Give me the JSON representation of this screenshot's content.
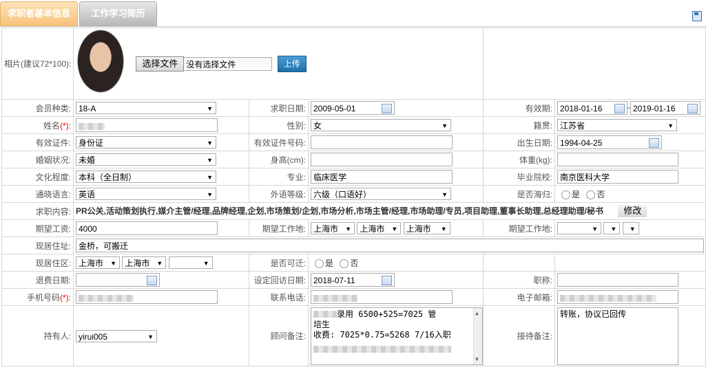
{
  "tabs": {
    "active": "求职者基本信息",
    "inactive": "工作学习简历"
  },
  "photo": {
    "label": "相片(建议72*100):",
    "choose_file": "选择文件",
    "no_file": "没有选择文件",
    "upload": "上传"
  },
  "row1": {
    "member_type_label": "会员种类:",
    "member_type": "18-A",
    "apply_date_label": "求职日期:",
    "apply_date": "2009-05-01",
    "valid_label": "有效期:",
    "valid_from": "2018-01-16",
    "valid_sep": "-",
    "valid_to": "2019-01-16"
  },
  "row2": {
    "name_label": "姓名",
    "req": "(*)",
    "gender_label": "性别:",
    "gender": "女",
    "native_label": "籍贯:",
    "native": "江苏省"
  },
  "row3": {
    "id_type_label": "有效证件:",
    "id_type": "身份证",
    "id_no_label": "有效证件号码:",
    "birth_label": "出生日期:",
    "birth": "1994-04-25"
  },
  "row4": {
    "marital_label": "婚姻状况:",
    "marital": "未婚",
    "height_label": "身高(cm):",
    "weight_label": "体重(kg):"
  },
  "row5": {
    "edu_label": "文化程度:",
    "edu": "本科（全日制）",
    "major_label": "专业:",
    "major": "临床医学",
    "school_label": "毕业院校:",
    "school": "南京医科大学"
  },
  "row6": {
    "lang_label": "通晓语言:",
    "lang": "英语",
    "level_label": "外语等级:",
    "level": "六级（口语好）",
    "overseas_label": "是否海归:",
    "yes": "是",
    "no": "否"
  },
  "row7": {
    "content_label": "求职内容:",
    "content": "PR公关,活动策划执行,媒介主管/经理,品牌经理,企划,市场策划/企划,市场分析,市场主管/经理,市场助理/专员,项目助理,董事长助理,总经理助理/秘书",
    "modify": "修改"
  },
  "row8": {
    "salary_label": "期望工资:",
    "salary": "4000",
    "place_label": "期望工作地:",
    "p1": "上海市",
    "p2": "上海市",
    "p3": "上海市",
    "place2_label": "期望工作地:"
  },
  "row9": {
    "addr_label": "现居住址:",
    "addr": "金桥，可搬迁"
  },
  "row10": {
    "area_label": "现居住区:",
    "a1": "上海市",
    "a2": "上海市",
    "move_label": "是否可迁:",
    "yes": "是",
    "no": "否"
  },
  "row11": {
    "refund_label": "退费日期:",
    "revisit_label": "设定回访日期:",
    "revisit": "2018-07-11",
    "title_label": "职称:"
  },
  "row12": {
    "mobile_label": "手机号码",
    "req": "(*)",
    "phone_label": "联系电话:",
    "email_label": "电子邮箱:"
  },
  "row13": {
    "holder_label": "持有人:",
    "holder": "yirui005",
    "remark_label": "顾问备注:",
    "remark_l1": "录用  6500+525=7025   管",
    "remark_l2": "培生",
    "remark_l3": "收费: 7025*0.75=5268  7/16入职",
    "reception_label": "接待备注:",
    "reception": "转账，协议已回传"
  }
}
